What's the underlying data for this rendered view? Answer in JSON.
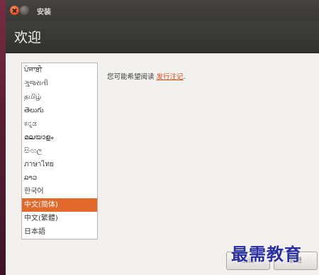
{
  "window": {
    "title": "安装"
  },
  "page": {
    "title": "欢迎"
  },
  "language_list": {
    "items": [
      "ਪੰਜਾਬੀ",
      "ગુજરાતી",
      "தமிழ்",
      "తెలుగు",
      "ಕನ್ನಡ",
      "മലയാളം",
      "සිංහල",
      "ภาษาไทย",
      "ລາວ",
      "한국어",
      "中文(简体)",
      "中文(繁體)",
      "日本語"
    ],
    "selected": "中文(简体)"
  },
  "release_notes": {
    "prefix": "您可能希望阅读",
    "link": "发行注记",
    "suffix": "."
  },
  "buttons": {
    "back": "后退",
    "forward": "前进"
  },
  "watermark": {
    "text": "最需教育"
  },
  "colors": {
    "accent": "#dd4814",
    "selection": "#e0692b",
    "titlebar": "#3c3b37",
    "window_bg": "#f2f1f0"
  }
}
